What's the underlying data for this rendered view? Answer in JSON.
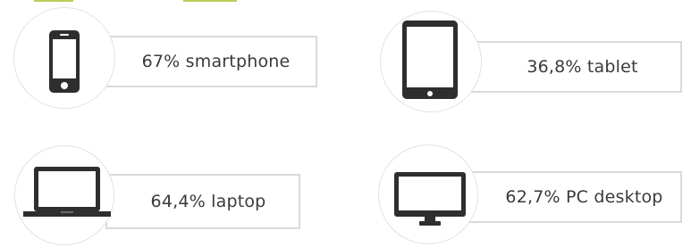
{
  "accent_color": "#b7cf5a",
  "icon_color": "#2e2e2e",
  "stats": [
    {
      "label": "67% smartphone",
      "icon": "smartphone-icon"
    },
    {
      "label": "36,8% tablet",
      "icon": "tablet-icon"
    },
    {
      "label": "64,4% laptop",
      "icon": "laptop-icon"
    },
    {
      "label": "62,7% PC desktop",
      "icon": "desktop-monitor-icon"
    }
  ]
}
